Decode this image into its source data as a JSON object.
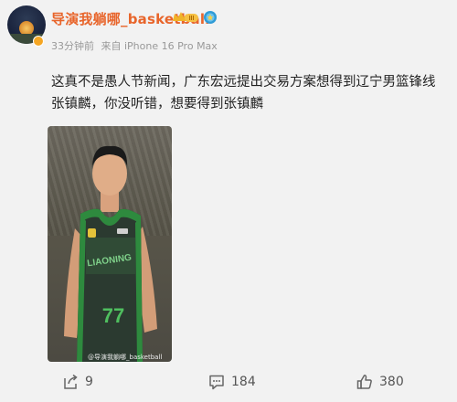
{
  "post": {
    "username": "导演我躺哪_basketball",
    "vip_level": "III",
    "time": "33分钟前",
    "source": "来自 iPhone 16 Pro Max",
    "text": "这真不是愚人节新闻，广东宏远提出交易方案想得到辽宁男篮锋线张镇麟，你没听错，想要得到张镇麟",
    "image": {
      "jersey_team": "LIAONING",
      "jersey_number": "77",
      "watermark": "@导演我躺哪_basketball"
    }
  },
  "actions": {
    "share_count": "9",
    "comment_count": "184",
    "like_count": "380"
  },
  "colors": {
    "username": "#e8652b",
    "vip_badge": "#f5a623",
    "background": "#f2f2f2"
  },
  "icons": [
    "verified-v-icon",
    "vip-crown-icon",
    "medal-icon",
    "share-icon",
    "comment-icon",
    "like-icon"
  ]
}
